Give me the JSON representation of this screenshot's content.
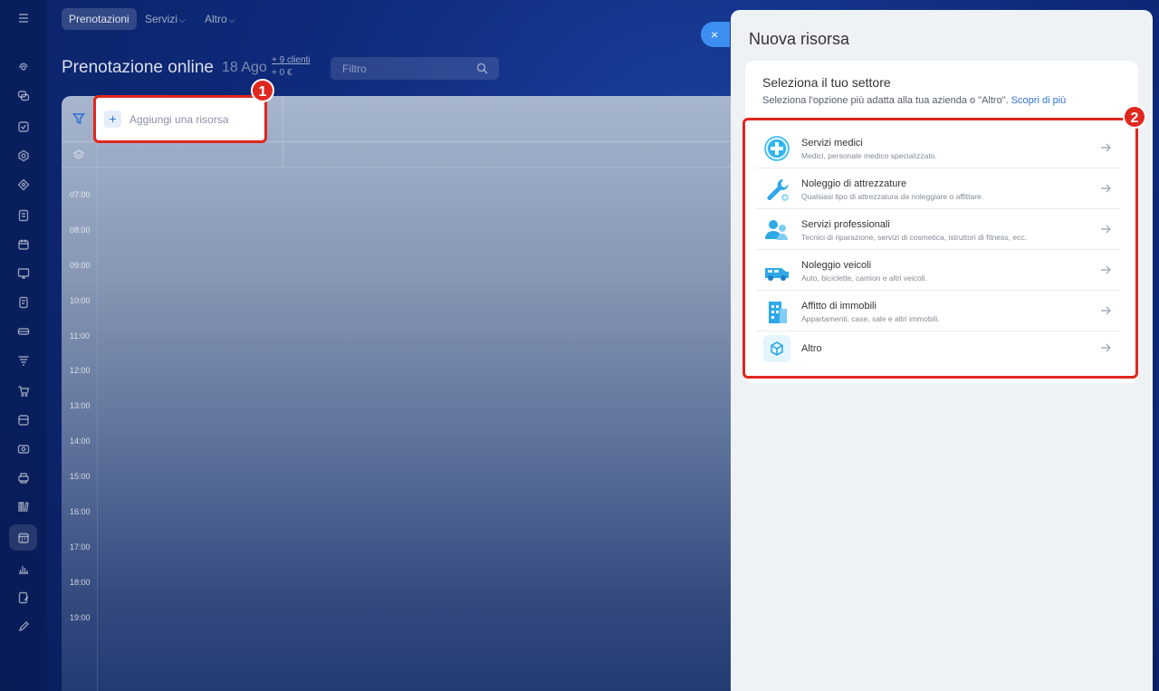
{
  "topbar": {
    "tabs": [
      {
        "label": "Prenotazioni"
      },
      {
        "label": "Servizi"
      },
      {
        "label": "Altro"
      }
    ]
  },
  "header": {
    "title": "Prenotazione online",
    "date": "18 Ago",
    "clients": "+ 9 clienti",
    "amount": "+ 0 €",
    "filter_placeholder": "Filtro"
  },
  "calendar": {
    "add_resource_label": "Aggiungi una risorsa",
    "plus_symbol": "+",
    "times": [
      "07:00",
      "08:00",
      "09:00",
      "10:00",
      "11:00",
      "12:00",
      "13:00",
      "14:00",
      "15:00",
      "16:00",
      "17:00",
      "18:00",
      "19:00"
    ]
  },
  "annotations": {
    "badge1": "1",
    "badge2": "2"
  },
  "slider": {
    "close_symbol": "×",
    "title": "Nuova risorsa",
    "card_title": "Seleziona il tuo settore",
    "card_subtitle": "Seleziona l'opzione più adatta alla tua azienda o \"Altro\".",
    "card_link": "Scopri di più",
    "options": [
      {
        "title": "Servizi medici",
        "desc": "Medici, personale medico specializzato.",
        "icon": "medical-cross-icon"
      },
      {
        "title": "Noleggio di attrezzature",
        "desc": "Qualsiasi tipo di attrezzatura da noleggiare o affittare.",
        "icon": "wrench-icon"
      },
      {
        "title": "Servizi professionali",
        "desc": "Tecnici di riparazione, servizi di cosmetica, istruttori di fitness, ecc.",
        "icon": "people-icon"
      },
      {
        "title": "Noleggio veicoli",
        "desc": "Auto, biciclette, camion e altri veicoli.",
        "icon": "van-icon"
      },
      {
        "title": "Affitto di immobili",
        "desc": "Appartamenti, case, sale e altri immobili.",
        "icon": "building-icon"
      },
      {
        "title": "Altro",
        "desc": "",
        "icon": "cube-icon"
      }
    ]
  },
  "colors": {
    "accent": "#2f74d1",
    "highlight": "#e0271e",
    "panel_bg": "#eef2f5"
  }
}
